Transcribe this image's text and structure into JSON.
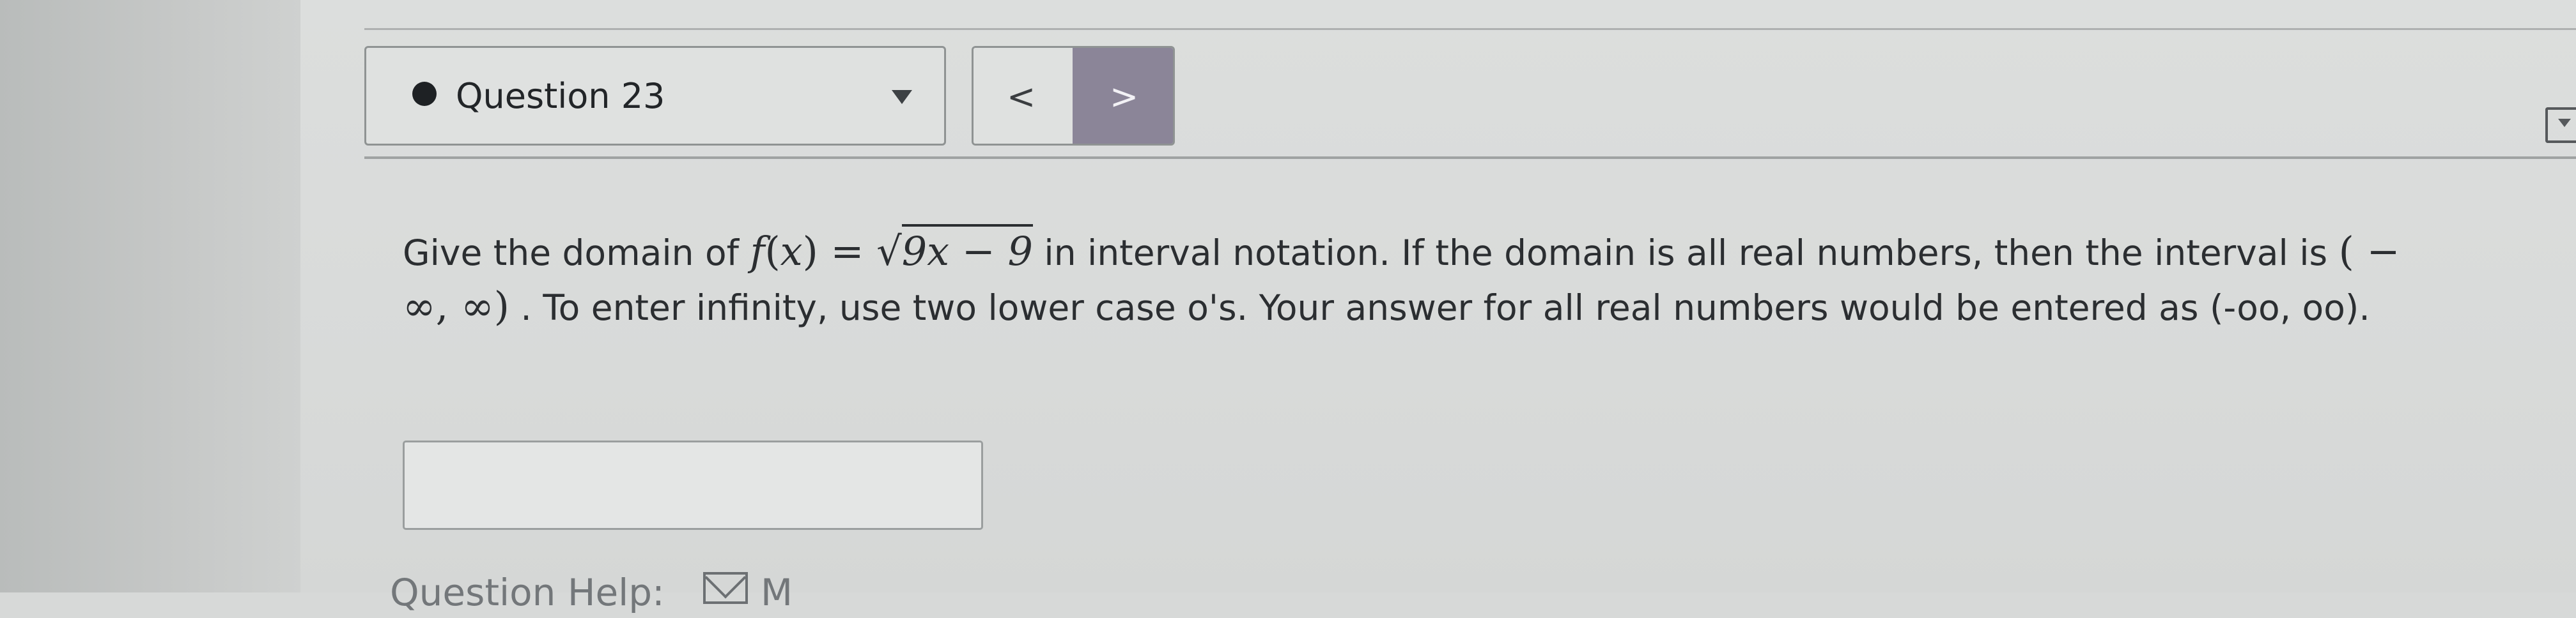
{
  "question": {
    "selector_label": "Question 23",
    "status": "answered-dot",
    "prev_glyph": "<",
    "next_glyph": ">"
  },
  "prompt": {
    "part1": "Give the domain of ",
    "f": "f",
    "paren_open": "(",
    "x": "x",
    "paren_close": ")",
    "equals": " = ",
    "sqrt_sign": "√",
    "sqrt_expr": "9x − 9",
    "part2": " in interval notation. If the domain is all real numbers, then the interval is ",
    "interval": "( − ∞, ∞)",
    "part3": " . To enter infinity, use two lower case o's.  Your answer for all real numbers would be entered as (-oo, oo)."
  },
  "answer": {
    "value": "",
    "placeholder": ""
  },
  "help": {
    "label": "Question Help:",
    "trailing": "M"
  },
  "icons": {
    "dropdown": "dropdown-arrow-icon",
    "prev": "chevron-left-icon",
    "next": "chevron-right-icon",
    "mail": "mail-icon",
    "side": "collapse-icon"
  },
  "colors": {
    "next_button": "#8b8598",
    "background": "#d9dbda",
    "text": "#2b2e31"
  }
}
